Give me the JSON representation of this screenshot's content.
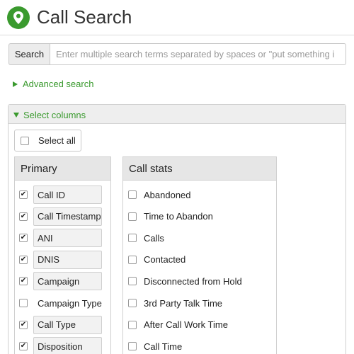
{
  "header": {
    "title": "Call Search",
    "logo_icon": "map-pin-logo-icon",
    "accent": "#3a9a2e"
  },
  "search": {
    "button_label": "Search",
    "placeholder": "Enter multiple search terms separated by spaces or \"put something i"
  },
  "advanced_search": {
    "label": "Advanced search",
    "expanded": false
  },
  "select_columns": {
    "label": "Select columns",
    "expanded": true,
    "select_all": {
      "label": "Select all",
      "checked": false
    },
    "primary": {
      "header": "Primary",
      "items": [
        {
          "label": "Call ID",
          "checked": true
        },
        {
          "label": "Call Timestamp",
          "checked": true
        },
        {
          "label": "ANI",
          "checked": true
        },
        {
          "label": "DNIS",
          "checked": true
        },
        {
          "label": "Campaign",
          "checked": true
        },
        {
          "label": "Campaign Type",
          "checked": false
        },
        {
          "label": "Call Type",
          "checked": true
        },
        {
          "label": "Disposition",
          "checked": true
        }
      ]
    },
    "call_stats": {
      "header": "Call stats",
      "items": [
        {
          "label": "Abandoned",
          "checked": false
        },
        {
          "label": "Time to Abandon",
          "checked": false
        },
        {
          "label": "Calls",
          "checked": false
        },
        {
          "label": "Contacted",
          "checked": false
        },
        {
          "label": "Disconnected from Hold",
          "checked": false
        },
        {
          "label": "3rd Party Talk Time",
          "checked": false
        },
        {
          "label": "After Call Work Time",
          "checked": false
        },
        {
          "label": "Call Time",
          "checked": false
        }
      ]
    }
  }
}
